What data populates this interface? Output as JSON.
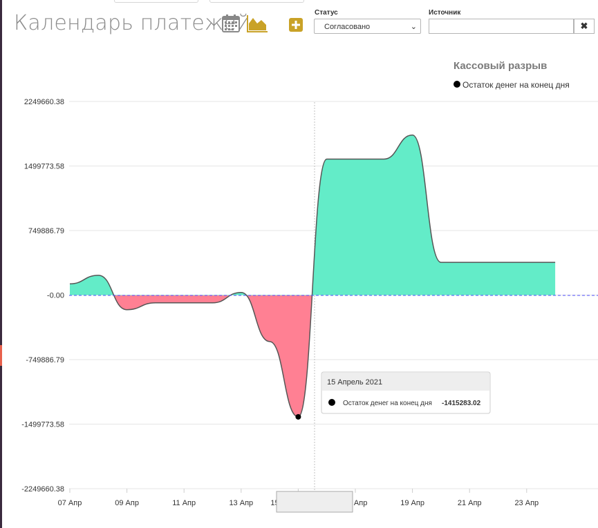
{
  "header": {
    "title": "Календарь платежей",
    "icons": [
      "calendar-icon",
      "area-chart-icon",
      "plus-icon"
    ],
    "accent_color": "#c9a227"
  },
  "filters": {
    "status_label": "Статус",
    "status_value": "Согласовано",
    "source_label": "Источник",
    "source_value": "",
    "clear_symbol": "✖"
  },
  "chart_data": {
    "type": "area",
    "title": "Кассовый разрыв",
    "legend_position": "top-right",
    "series": [
      {
        "name": "Остаток денег на конец дня",
        "positive_color": "#63ecc8",
        "negative_color": "#ff8093"
      }
    ],
    "y_ticks": [
      2249660.38,
      1499773.58,
      749886.79,
      0,
      -749886.79,
      -1499773.58,
      -2249660.38
    ],
    "y_tick_labels": [
      "2249660.38",
      "1499773.58",
      "749886.79",
      "-0.00",
      "-749886.79",
      "-1499773.58",
      "-2249660.38"
    ],
    "ylim": [
      -2249660.38,
      2249660.38
    ],
    "x_tick_labels": [
      "07 Апр",
      "09 Апр",
      "11 Апр",
      "13 Апр",
      "15 Апрель 2021",
      "17 Апр",
      "19 Апр",
      "21 Апр",
      "23 Апр"
    ],
    "x_tick_dates": [
      "2021-04-07",
      "2021-04-09",
      "2021-04-11",
      "2021-04-13",
      "2021-04-15",
      "2021-04-17",
      "2021-04-19",
      "2021-04-21",
      "2021-04-23"
    ],
    "points": [
      {
        "x": "2021-04-07",
        "y": 130000
      },
      {
        "x": "2021-04-08",
        "y": 230000
      },
      {
        "x": "2021-04-09",
        "y": -170000
      },
      {
        "x": "2021-04-10",
        "y": -90000
      },
      {
        "x": "2021-04-11",
        "y": -90000
      },
      {
        "x": "2021-04-12",
        "y": -90000
      },
      {
        "x": "2021-04-13",
        "y": 30000
      },
      {
        "x": "2021-04-14",
        "y": -540000
      },
      {
        "x": "2021-04-15",
        "y": -1415283.02
      },
      {
        "x": "2021-04-16",
        "y": 1580000
      },
      {
        "x": "2021-04-17",
        "y": 1580000
      },
      {
        "x": "2021-04-18",
        "y": 1580000
      },
      {
        "x": "2021-04-19",
        "y": 1860000
      },
      {
        "x": "2021-04-20",
        "y": 380000
      },
      {
        "x": "2021-04-21",
        "y": 380000
      },
      {
        "x": "2021-04-22",
        "y": 380000
      },
      {
        "x": "2021-04-23",
        "y": 380000
      },
      {
        "x": "2021-04-24",
        "y": 380000
      }
    ],
    "tooltip": {
      "date": "15 Апрель 2021",
      "series_name": "Остаток денег на конец дня",
      "value": "-1415283.02"
    }
  }
}
